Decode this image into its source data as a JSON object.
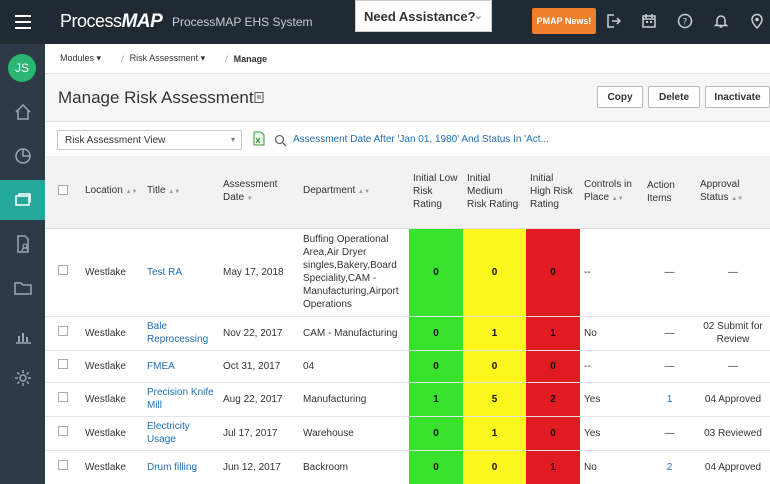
{
  "header": {
    "brand_part1": "Process",
    "brand_part2": "MAP",
    "system_name": "ProcessMAP EHS System",
    "assist_label": "Need Assistance?",
    "news_label": "PMAP News!"
  },
  "sidebar": {
    "avatar_initials": "JS"
  },
  "breadcrumb": {
    "modules": "Modules",
    "risk_assessment": "Risk Assessment",
    "current": "Manage"
  },
  "page": {
    "title": "Manage Risk Assessment",
    "buttons": {
      "copy": "Copy",
      "delete": "Delete",
      "inactivate": "Inactivate"
    }
  },
  "filter": {
    "view_name": "Risk Assessment View",
    "criteria_text": "Assessment Date After 'Jan 01, 1980' And Status In 'Act..."
  },
  "table": {
    "columns": {
      "location": "Location",
      "title": "Title",
      "assessment_date": "Assessment Date",
      "department": "Department",
      "initial_low": "Initial Low Risk Rating",
      "initial_medium": "Initial Medium Risk Rating",
      "initial_high": "Initial High Risk Rating",
      "controls": "Controls in Place",
      "action_items": "Action Items",
      "approval_status": "Approval Status"
    },
    "rows": [
      {
        "location": "Westlake",
        "title": "Test RA",
        "date": "May 17, 2018",
        "department": "Buffing Operational Area,Air Dryer singles,Bakery,Board Speciality,CAM - Manufacturing,Airport Operations",
        "low": "0",
        "medium": "0",
        "high": "0",
        "controls": "--",
        "actions": "—",
        "status": "—"
      },
      {
        "location": "Westlake",
        "title": "Bale Reprocessing",
        "date": "Nov 22, 2017",
        "department": "CAM - Manufacturing",
        "low": "0",
        "medium": "1",
        "high": "1",
        "controls": "No",
        "actions": "—",
        "status": "02 Submit for Review"
      },
      {
        "location": "Westlake",
        "title": "FMEA",
        "date": "Oct 31, 2017",
        "department": "04",
        "low": "0",
        "medium": "0",
        "high": "0",
        "controls": "--",
        "actions": "—",
        "status": "—"
      },
      {
        "location": "Westlake",
        "title": "Precision Knife Mill",
        "date": "Aug 22, 2017",
        "department": "Manufacturing",
        "low": "1",
        "medium": "5",
        "high": "2",
        "controls": "Yes",
        "actions": "1",
        "status": "04 Approved"
      },
      {
        "location": "Westlake",
        "title": "Electricity Usage",
        "date": "Jul 17, 2017",
        "department": "Warehouse",
        "low": "0",
        "medium": "1",
        "high": "0",
        "controls": "Yes",
        "actions": "—",
        "status": "03 Reviewed"
      },
      {
        "location": "Westlake",
        "title": "Drum filling",
        "date": "Jun 12, 2017",
        "department": "Backroom",
        "low": "0",
        "medium": "0",
        "high": "1",
        "controls": "No",
        "actions": "2",
        "status": "04 Approved"
      }
    ]
  },
  "colors": {
    "low": "#39e22c",
    "medium": "#fcf71f",
    "high": "#e21a22",
    "accent": "#24a89b",
    "news": "#f07f2d"
  }
}
